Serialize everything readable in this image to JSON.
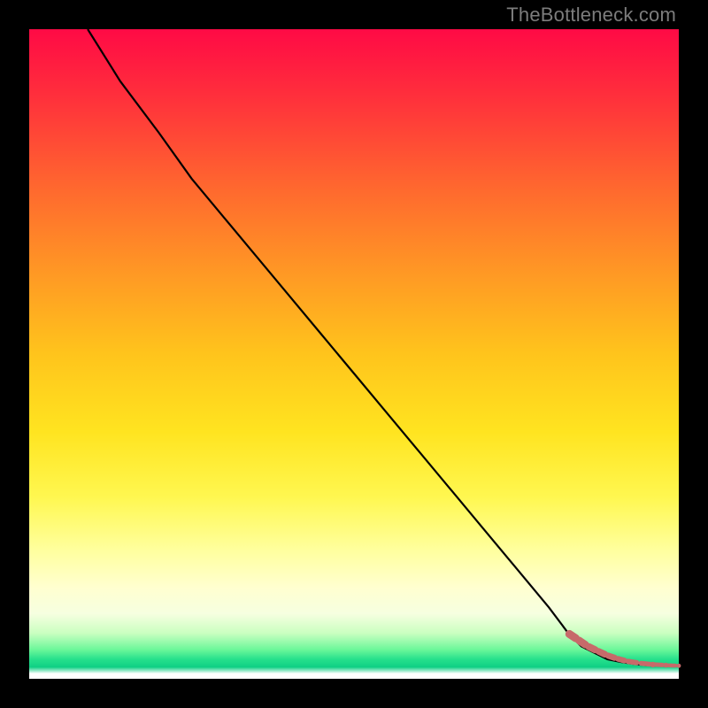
{
  "watermark": "TheBottleneck.com",
  "chart_data": {
    "type": "line",
    "title": "",
    "xlabel": "",
    "ylabel": "",
    "xlim": [
      0,
      100
    ],
    "ylim": [
      0,
      100
    ],
    "series": [
      {
        "name": "curve",
        "x": [
          9,
          14,
          20,
          25,
          30,
          35,
          40,
          45,
          50,
          55,
          60,
          65,
          70,
          75,
          80,
          83,
          85,
          87,
          89,
          91,
          93,
          95,
          97,
          99,
          100
        ],
        "y": [
          100,
          92,
          84,
          77,
          71,
          65,
          59,
          53,
          47,
          41,
          35,
          29,
          23,
          17,
          11,
          7,
          5,
          4,
          3,
          2.6,
          2.3,
          2.1,
          2.0,
          2.0,
          2.0
        ]
      }
    ],
    "tail_markers": {
      "name": "dashed-tail",
      "color": "#c76a6a",
      "x": [
        83,
        84.5,
        86,
        87.5,
        89,
        90.5,
        92,
        94,
        96,
        98,
        100
      ],
      "y": [
        7,
        6,
        5,
        4.3,
        3.6,
        3.1,
        2.7,
        2.4,
        2.2,
        2.1,
        2.0
      ]
    }
  },
  "colors": {
    "curve": "#000000",
    "marker": "#c76a6a",
    "background_black": "#000000"
  }
}
